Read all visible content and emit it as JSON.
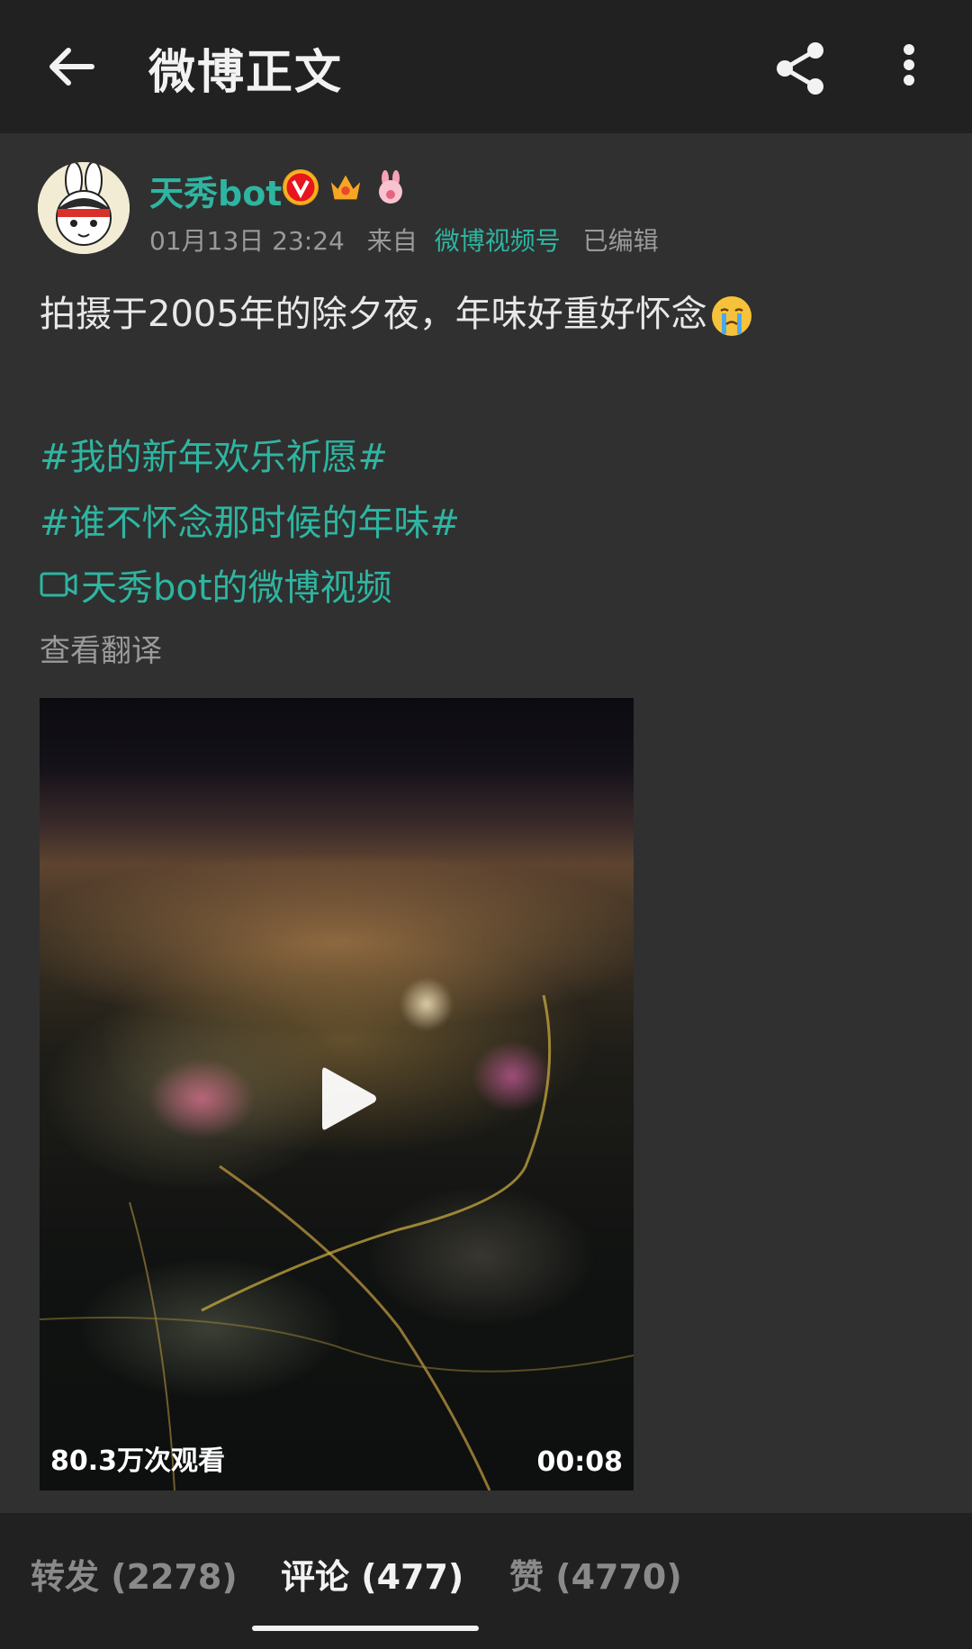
{
  "header": {
    "title": "微博正文",
    "back_icon": "arrow-left-icon",
    "share_icon": "share-icon",
    "more_icon": "more-vertical-icon"
  },
  "post": {
    "author": "天秀bot",
    "date": "01月13日 23:24",
    "from_label": "来自",
    "source": "微博视频号",
    "edited": "已编辑",
    "text": "拍摄于2005年的除夕夜，年味好重好怀念",
    "topics": [
      "#我的新年欢乐祈愿#",
      "#谁不怀念那时候的年味#"
    ],
    "video_link": "天秀bot的微博视频",
    "translate": "查看翻译",
    "video": {
      "views": "80.3万次观看",
      "duration": "00:08"
    }
  },
  "tabs": {
    "repost": "转发 (2278)",
    "comment": "评论 (477)",
    "like": "赞 (4770)"
  },
  "colors": {
    "accent": "#2eb5a1",
    "background": "#303030",
    "bar": "#212121"
  }
}
